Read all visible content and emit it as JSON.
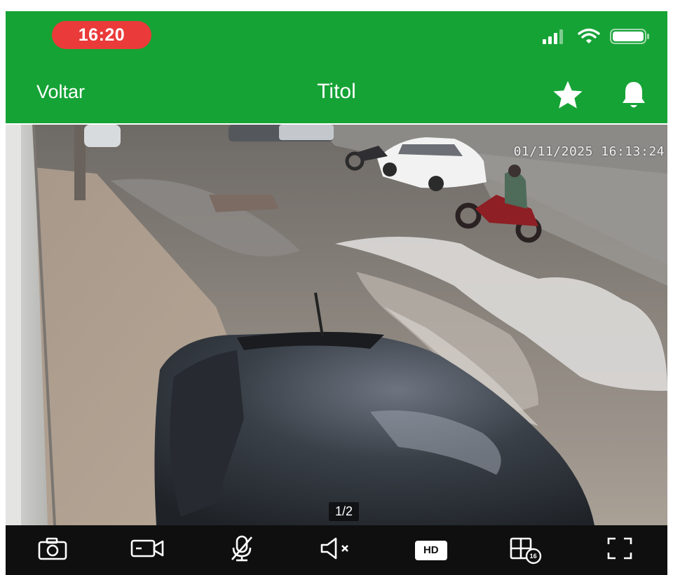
{
  "status_bar": {
    "time": "16:20",
    "icons": [
      "signal-icon",
      "wifi-icon",
      "battery-icon"
    ]
  },
  "nav": {
    "back_label": "Voltar",
    "title": "Titol",
    "actions": [
      "star-icon",
      "bell-icon"
    ]
  },
  "video": {
    "timestamp": "01/11/2025 16:13:24",
    "page_indicator": "1/2"
  },
  "toolbar": {
    "tools": [
      "camera-icon",
      "record-icon",
      "mic-off-icon",
      "speaker-mute-icon",
      "hd-icon",
      "multi-screen-icon",
      "fullscreen-icon"
    ],
    "hd_label": "HD",
    "split_count": "16"
  },
  "colors": {
    "header": "#16a336",
    "time_pill": "#ea3a3a",
    "toolbar": "#0f0f0f"
  }
}
